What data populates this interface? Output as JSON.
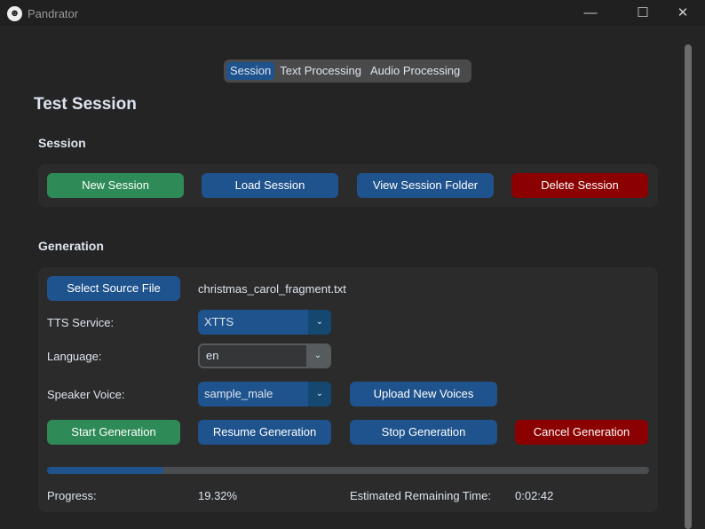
{
  "window": {
    "title": "Pandrator",
    "minimize": "—",
    "maximize": "☐",
    "close": "✕"
  },
  "tabs": [
    {
      "label": "Session",
      "active": true
    },
    {
      "label": "Text Processing"
    },
    {
      "label": "Audio Processing"
    }
  ],
  "session_name": "Test Session",
  "session": {
    "heading": "Session",
    "new": "New Session",
    "load": "Load Session",
    "view": "View Session Folder",
    "delete": "Delete Session"
  },
  "generation": {
    "heading": "Generation",
    "select_source": "Select Source File",
    "source_file": "christmas_carol_fragment.txt",
    "tts_label": "TTS Service:",
    "tts_value": "XTTS",
    "language_label": "Language:",
    "language_value": "en",
    "voice_label": "Speaker Voice:",
    "voice_value": "sample_male",
    "upload_voices": "Upload New Voices",
    "start": "Start Generation",
    "resume": "Resume Generation",
    "stop": "Stop Generation",
    "cancel": "Cancel Generation",
    "progress_label": "Progress:",
    "progress_value": "19.32%",
    "progress_fraction": 0.1932,
    "eta_label": "Estimated Remaining Time:",
    "eta_value": "0:02:42"
  },
  "colors": {
    "accent": "#1f538d",
    "success": "#2e8b57",
    "danger": "#8b0000"
  }
}
